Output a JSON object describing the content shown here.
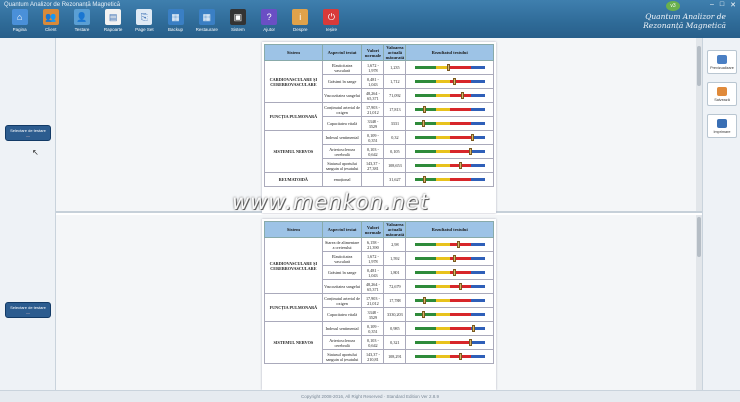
{
  "window": {
    "title": "Quantum Analizor de Rezonanță Magnetică",
    "controls": [
      "–",
      "□",
      "✕"
    ]
  },
  "brand": {
    "line1": "Quantum Analizor de",
    "line2": "Rezonanță Magnetică",
    "badge": "v3"
  },
  "toolbar": [
    {
      "label": "Pagina",
      "icon": "home-icon",
      "color": "#4a90d9"
    },
    {
      "label": "Client",
      "icon": "users-icon",
      "color": "#d88a3a"
    },
    {
      "label": "Testare",
      "icon": "person-icon",
      "color": "#5a9fd4"
    },
    {
      "label": "Rapoarte",
      "icon": "report-icon",
      "color": "#f2f2f2"
    },
    {
      "label": "Page Set",
      "icon": "page-setup-icon",
      "color": "#dfeaf5"
    },
    {
      "label": "Backup",
      "icon": "backup-icon",
      "color": "#3a7fc4"
    },
    {
      "label": "Restaurare",
      "icon": "restore-icon",
      "color": "#3a7fc4"
    },
    {
      "label": "Sistem",
      "icon": "system-icon",
      "color": "#333333"
    },
    {
      "label": "Ajutor",
      "icon": "help-icon",
      "color": "#6a4fc4"
    },
    {
      "label": "Despre",
      "icon": "about-icon",
      "color": "#e0a24a"
    },
    {
      "label": "Ieșire",
      "icon": "exit-icon",
      "color": "#d83a3a"
    }
  ],
  "left_panel": {
    "select_label": "Selectare de testare",
    "select_sub": "—"
  },
  "right_panel": [
    {
      "label": "Previzualizare",
      "icon": "preview-icon",
      "color": "#4a7fc4"
    },
    {
      "label": "Salvează",
      "icon": "save-icon",
      "color": "#e08a3a"
    },
    {
      "label": "Imprimare",
      "icon": "print-icon",
      "color": "#3a6fb4"
    }
  ],
  "table_headers": {
    "system": "Sistem",
    "aspect": "Aspectul testat",
    "normal": "Valori normale",
    "actual": "Valoarea actuală măsurată",
    "result": "Rezultatul testului"
  },
  "report_top": {
    "rows": [
      {
        "system": "CARDIOVASCULARE ȘI CEREBROVASCULARE",
        "aspect": "Elasticitatea vasculară",
        "normal": "1,672 - 1,978",
        "value": "1,235",
        "pos": 0.46
      },
      {
        "system": "",
        "aspect": "Grăsimi în sange",
        "normal": "0,481 - 1,043",
        "value": "1,712",
        "pos": 0.55
      },
      {
        "system": "",
        "aspect": "Vascozitatea sangelui",
        "normal": "48,264 - 65,371",
        "value": "71,092",
        "pos": 0.66
      },
      {
        "system": "FUNCȚIA PULMONARĂ",
        "aspect": "Conținutul arterial de oxigen",
        "normal": "17,903 - 21,012",
        "value": "17,813",
        "pos": 0.12
      },
      {
        "system": "",
        "aspect": "Capacitatea vitală",
        "normal": "3348 - 3529",
        "value": "3331",
        "pos": 0.1
      },
      {
        "system": "SISTEMUL NERVOS",
        "aspect": "Indexul sentimental",
        "normal": "0,109 - 0,351",
        "value": "0,32",
        "pos": 0.81
      },
      {
        "system": "",
        "aspect": "Arterioscleroza cerebrală",
        "normal": "0,103 - 0,642",
        "value": "0,105",
        "pos": 0.78
      },
      {
        "system": "",
        "aspect": "Statusul aportului sanguin al țesutului",
        "normal": "143,37 - 27,381",
        "value": "108,653",
        "pos": 0.64
      },
      {
        "system": "REUMATOIDĂ",
        "aspect": "emoțional",
        "normal": "",
        "value": "31,627",
        "pos": 0.12
      }
    ]
  },
  "report_bottom": {
    "rows": [
      {
        "system": "CARDIOVASCULARE ȘI CEREBROVASCULARE",
        "aspect": "Starea de alimentare a creierului",
        "normal": "6,158 - 21,390",
        "value": "2,98",
        "pos": 0.6
      },
      {
        "system": "",
        "aspect": "Elasticitatea vasculară",
        "normal": "1,672 - 1,978",
        "value": "1,592",
        "pos": 0.55
      },
      {
        "system": "",
        "aspect": "Grăsimi în sange",
        "normal": "0,481 - 1,043",
        "value": "1,801",
        "pos": 0.55
      },
      {
        "system": "",
        "aspect": "Vascozitatea sangelui",
        "normal": "48,264 - 65,371",
        "value": "72,679",
        "pos": 0.64
      },
      {
        "system": "FUNCȚIA PULMONARĂ",
        "aspect": "Conținutul arterial de oxigen",
        "normal": "17,903 - 21,012",
        "value": "17,788",
        "pos": 0.12
      },
      {
        "system": "",
        "aspect": "Capacitatea vitală",
        "normal": "3348 - 3529",
        "value": "3330,203",
        "pos": 0.1
      },
      {
        "system": "SISTEMUL NERVOS",
        "aspect": "Indexul sentimental",
        "normal": "0,109 - 0,351",
        "value": "0,985",
        "pos": 0.82
      },
      {
        "system": "",
        "aspect": "Arterioscleroza cerebrală",
        "normal": "0,103 - 0,642",
        "value": "0,321",
        "pos": 0.78
      },
      {
        "system": "",
        "aspect": "Statusul aportului sanguin al țesutului",
        "normal": "143,37 - 210,81",
        "value": "108,291",
        "pos": 0.64
      }
    ]
  },
  "watermark": "www.menkon.net",
  "status": "Copyright 2008-2016, All Right Reserved · Standard Edition Ver 2.8.9"
}
